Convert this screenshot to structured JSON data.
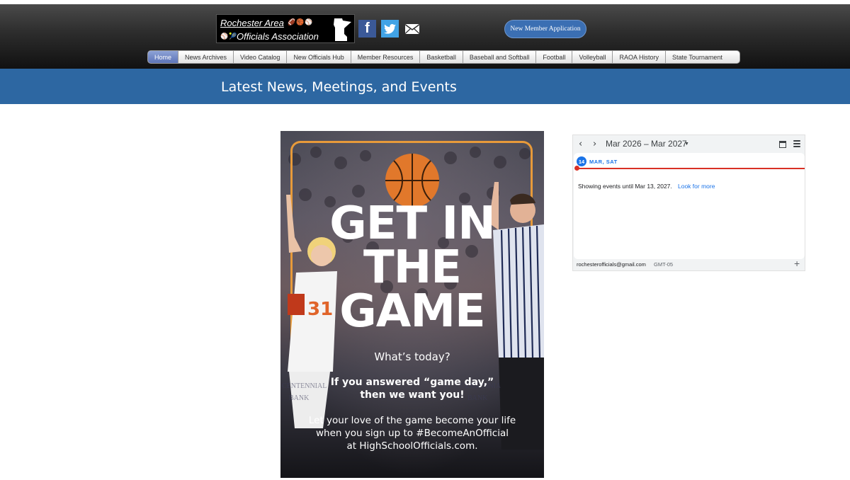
{
  "header": {
    "logo": {
      "line1": "Rochester Area",
      "line2": "Officials Association"
    },
    "social": {
      "facebook_glyph": "f",
      "icons": [
        "facebook-icon",
        "twitter-icon",
        "mail-icon"
      ]
    },
    "join_button": "New Member Application"
  },
  "nav": {
    "items": [
      {
        "label": "Home",
        "active": true
      },
      {
        "label": "News Archives"
      },
      {
        "label": "Video Catalog"
      },
      {
        "label": "New Officials Hub"
      },
      {
        "label": "Member Resources"
      },
      {
        "label": "Basketball"
      },
      {
        "label": "Baseball and Softball"
      },
      {
        "label": "Football"
      },
      {
        "label": "Volleyball"
      },
      {
        "label": "RAOA History"
      },
      {
        "label": "State Tournament"
      }
    ]
  },
  "banner": {
    "title": "Latest News, Meetings, and Events"
  },
  "poster": {
    "headline": [
      "GET IN",
      "THE",
      "GAME"
    ],
    "question": "What’s today?",
    "bold_line1": "If you answered “game day,”",
    "bold_line2": "then we want you!",
    "cta_line1": "Let your love of the game become your life",
    "cta_line2": "when you sign up to #BecomeAnOfficial",
    "cta_line3": "at HighSchoolOfficials.com.",
    "jersey_number": "31",
    "bank_text_left": "CENTENNIAL",
    "bank_text_right": "CENTENNIA",
    "bank_sub": "BANK"
  },
  "calendar": {
    "prev": "‹",
    "next": "›",
    "range": "Mar 2026 – Mar 2027",
    "day_number": "14",
    "day_label": "MAR, SAT",
    "message": "Showing events until Mar 13, 2027.",
    "look_more": "Look for more",
    "account": "rochesterofficials@gmail.com",
    "timezone": "GMT-05",
    "add": "+"
  },
  "colors": {
    "banner": "#2d67a2",
    "nav_active": "#6b80c2",
    "join_button": "#3b6fb3",
    "poster_frame": "#e79a3a",
    "calendar_accent": "#1a73e8",
    "now_line": "#d93025"
  }
}
